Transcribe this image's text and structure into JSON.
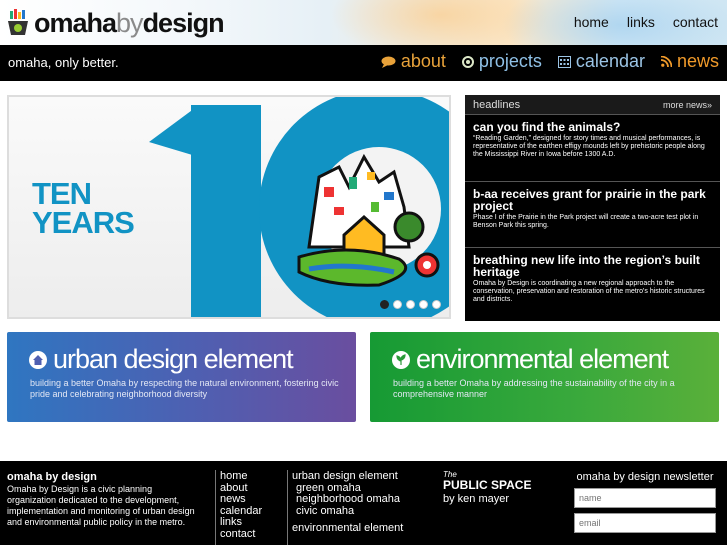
{
  "header": {
    "logo_word1": "omaha",
    "logo_word2": "by",
    "logo_word3": "design",
    "top_nav": [
      "home",
      "links",
      "contact"
    ]
  },
  "bar": {
    "tagline": "omaha, only better.",
    "main_nav": [
      {
        "label": "about",
        "icon": "speech-bubble-icon",
        "color": "#e8a23a"
      },
      {
        "label": "projects",
        "icon": "circle-icon",
        "color": "#8fc0e6"
      },
      {
        "label": "calendar",
        "icon": "calendar-icon",
        "color": "#9bc4e5"
      },
      {
        "label": "news",
        "icon": "rss-icon",
        "color": "#f09a2a"
      }
    ]
  },
  "slideshow": {
    "big_text_line1": "TEN",
    "big_text_line2": "YEARS",
    "slide_count": 5,
    "active_slide": 1,
    "accent": "#1193c4"
  },
  "headlines": {
    "title": "headlines",
    "more": "more news»",
    "items": [
      {
        "title": "can you find the animals?",
        "body": "“Reading Garden,” designed for story times and musical performances, is representative of the earthen effigy mounds left by prehistoric people along the Mississippi River in Iowa before 1300 A.D."
      },
      {
        "title": "b-aa receives grant for prairie in the park project",
        "body": "Phase I of the Prairie in the Park project will create a two-acre test plot in Benson Park this spring."
      },
      {
        "title": "breathing new life into the region’s built heritage",
        "body": "Omaha by Design is coordinating a new regional approach to the conservation, preservation and restoration of the metro's historic structures and districts."
      }
    ]
  },
  "panels": {
    "urban": {
      "title": "urban design element",
      "desc": "building a better Omaha by respecting the natural environment, fostering civic pride and celebrating neighborhood diversity",
      "icon": "house-icon"
    },
    "env": {
      "title": "environmental element",
      "desc": "building a better Omaha by addressing the sustainability of the city in a comprehensive manner",
      "icon": "leaf-icon"
    }
  },
  "footer": {
    "about_title": "omaha by design",
    "about_text": "Omaha by Design is a civic planning organization dedicated to the development, implementation and monitoring of urban design and environmental public policy in the metro.",
    "links": [
      "home",
      "about",
      "news",
      "calendar",
      "links",
      "contact"
    ],
    "urban_title": "urban design element",
    "urban_links": [
      "green omaha",
      "neighborhood omaha",
      "civic omaha"
    ],
    "env_title": "environmental element",
    "ps_the": "The",
    "ps_title": "PUBLIC SPACE",
    "ps_by": "by ken mayer",
    "newsletter_title": "omaha by design newsletter",
    "name_placeholder": "name",
    "email_placeholder": "email"
  }
}
